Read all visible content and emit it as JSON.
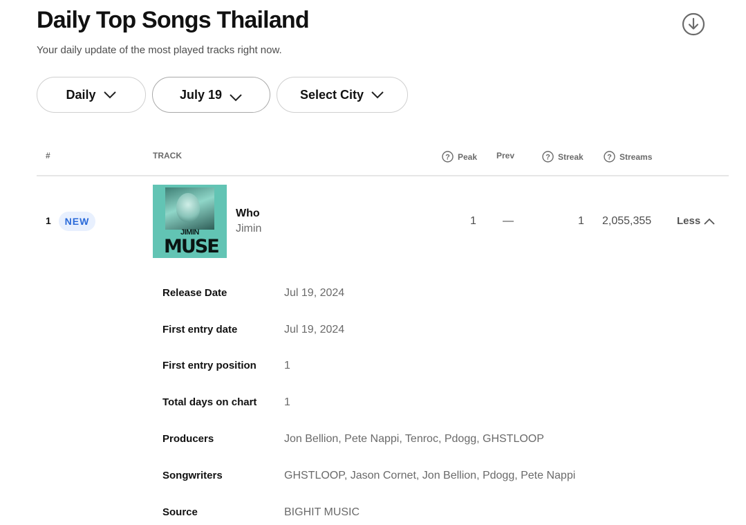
{
  "page": {
    "title": "Daily Top Songs Thailand",
    "subtitle": "Your daily update of the most played tracks right now."
  },
  "icons": {
    "download": "download-circle-icon",
    "chevron": "chevron-down-icon",
    "help": "question-circle-icon",
    "collapse": "chevron-up-icon"
  },
  "filters": {
    "frequency": "Daily",
    "date": "July 19",
    "city": "Select City"
  },
  "table": {
    "headers": {
      "rank": "#",
      "track": "TRACK",
      "peak": "Peak",
      "prev": "Prev",
      "streak": "Streak",
      "streams": "Streams"
    },
    "rows": [
      {
        "rank": "1",
        "badge": "NEW",
        "cover_text": {
          "artist": "JIMIN",
          "album": "MUSE"
        },
        "title": "Who",
        "artist": "Jimin",
        "peak": "1",
        "prev": "—",
        "streak": "1",
        "streams": "2,055,355",
        "toggle": "Less"
      }
    ]
  },
  "details": [
    {
      "label": "Release Date",
      "value": "Jul 19, 2024"
    },
    {
      "label": "First entry date",
      "value": "Jul 19, 2024"
    },
    {
      "label": "First entry position",
      "value": "1"
    },
    {
      "label": "Total days on chart",
      "value": "1"
    },
    {
      "label": "Producers",
      "value": "Jon Bellion, Pete Nappi, Tenroc, Pdogg, GHSTLOOP"
    },
    {
      "label": "Songwriters",
      "value": "GHSTLOOP, Jason Cornet, Jon Bellion, Pdogg, Pete Nappi"
    },
    {
      "label": "Source",
      "value": "BIGHIT MUSIC"
    }
  ]
}
